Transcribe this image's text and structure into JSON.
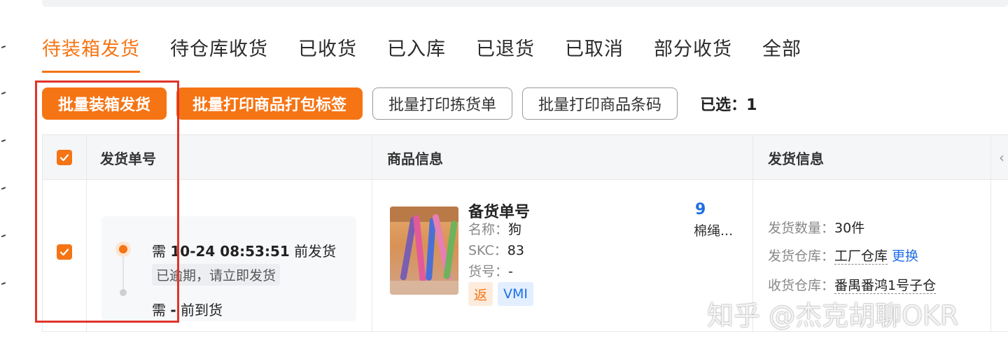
{
  "tabs": [
    {
      "label": "待装箱发货",
      "active": true
    },
    {
      "label": "待仓库收货",
      "active": false
    },
    {
      "label": "已收货",
      "active": false
    },
    {
      "label": "已入库",
      "active": false
    },
    {
      "label": "已退货",
      "active": false
    },
    {
      "label": "已取消",
      "active": false
    },
    {
      "label": "部分收货",
      "active": false
    },
    {
      "label": "全部",
      "active": false
    }
  ],
  "toolbar": {
    "batch_pack_ship": "批量装箱发货",
    "batch_print_labels": "批量打印商品打包标签",
    "batch_print_picklist": "批量打印拣货单",
    "batch_print_barcodes": "批量打印商品条码",
    "selected_count": "已选：1"
  },
  "table": {
    "headers": {
      "shipment_no": "发货单号",
      "product_info": "商品信息",
      "shipping_info": "发货信息"
    },
    "row": {
      "checked": true,
      "deadline_prefix": "需 ",
      "deadline_time": "10-24 08:53:51",
      "deadline_suffix": " 前发货",
      "overdue_warning": "已逾期，请立即发货",
      "arrival_prefix": "需 ",
      "arrival_time": "-",
      "arrival_suffix": " 前到货",
      "product": {
        "title": "备货单号",
        "title_tail": "9",
        "name_label": "名称：",
        "name_value": "狗",
        "name_tail": "棉绳...",
        "skc_label": "SKC：",
        "skc_value": "83",
        "sku_label": "货号：",
        "sku_value": "-",
        "tag_return": "返",
        "tag_vmi": "VMI"
      },
      "shipping": {
        "qty_label": "发货数量：",
        "qty_value": "30件",
        "warehouse_label": "发货仓库：",
        "warehouse_value": "工厂仓库",
        "change_link": "更换",
        "receive_label": "收货仓库：",
        "receive_value": "番禺番鸿1号子仓"
      }
    }
  },
  "watermark": "知乎 @杰克胡聊OKR",
  "colors": {
    "accent": "#f57414",
    "link": "#1f6fe5",
    "annotation": "#e0342b"
  }
}
